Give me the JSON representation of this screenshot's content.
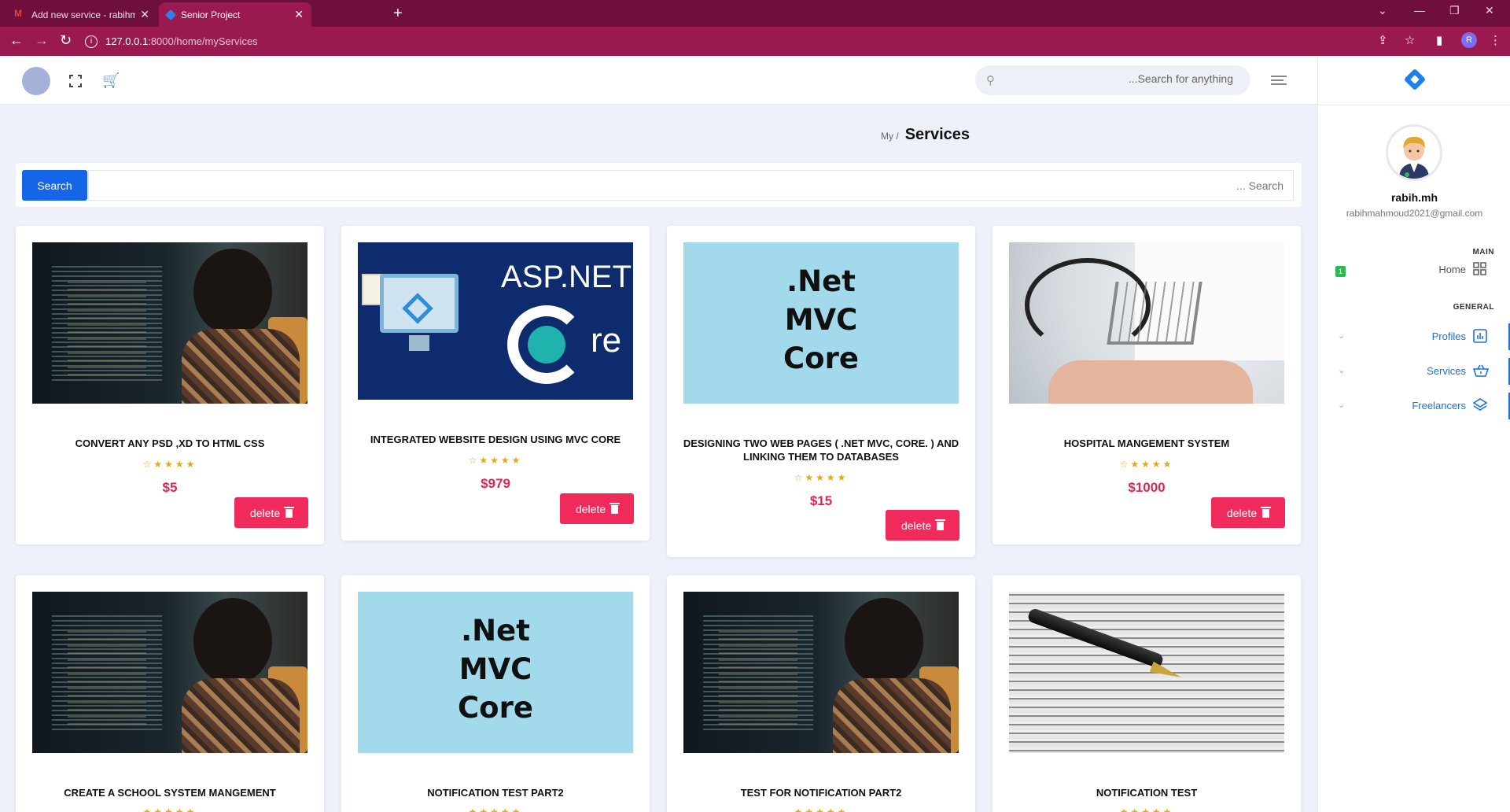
{
  "browser": {
    "tabs": [
      {
        "title": "Add new service - rabihmahmoud",
        "active": false
      },
      {
        "title": "Senior Project",
        "active": true
      }
    ],
    "url_host": "127.0.0.1",
    "url_rest": ":8000/home/myServices"
  },
  "header": {
    "search_placeholder": "...Search for anything"
  },
  "breadcrumb": {
    "parent": "My /",
    "title": "Services"
  },
  "search": {
    "button_label": "Search",
    "placeholder": "... Search"
  },
  "sidebar": {
    "user_name": "rabih.mh",
    "user_email": "rabihmahmoud2021@gmail.com",
    "section_main": "MAIN",
    "section_general": "GENERAL",
    "home_label": "Home",
    "home_badge": "1",
    "items": [
      {
        "label": "Profiles",
        "icon": "chart-icon"
      },
      {
        "label": "Services",
        "icon": "basket-icon"
      },
      {
        "label": "Freelancers",
        "icon": "layers-icon"
      }
    ]
  },
  "services": [
    {
      "title": "CONVERT ANY PSD ,XD TO HTML CSS",
      "price": "$5",
      "stars": "☆★★★★",
      "delete_label": "delete",
      "image": "programmer-coding"
    },
    {
      "title": "INTEGRATED WEBSITE DESIGN USING MVC CORE",
      "price": "$979",
      "stars": "☆★★★★",
      "delete_label": "delete",
      "image": "asp-net-core"
    },
    {
      "title": "DESIGNING TWO WEB PAGES ( .NET MVC, CORE. ) AND LINKING THEM TO DATABASES",
      "price": "$15",
      "stars": "☆★★★★",
      "delete_label": "delete",
      "image": "net-mvc-core"
    },
    {
      "title": "HOSPITAL MANGEMENT SYSTEM",
      "price": "$1000",
      "stars": "☆★★★★",
      "delete_label": "delete",
      "image": "hospital-cart"
    },
    {
      "title": "CREATE A SCHOOL SYSTEM MANGEMENT",
      "stars": "★★★★★",
      "image": "programmer-coding"
    },
    {
      "title": "NOTIFICATION TEST PART2",
      "stars": "★★★★★",
      "image": "net-mvc-core"
    },
    {
      "title": "TEST FOR NOTIFICATION PART2",
      "stars": "★★★★★",
      "image": "programmer-coding"
    },
    {
      "title": "NOTIFICATION TEST",
      "stars": "★★★★★",
      "image": "pen-paper"
    }
  ],
  "images": {
    "asp_text": "ASP.NET",
    "core_text": "re",
    "net_line1": ".Net",
    "net_line2": "MVC",
    "net_line3": "Core"
  },
  "colors": {
    "brand_tab": "#6f0f3d",
    "toolbar": "#9a1a4f",
    "primary": "#1565e8",
    "danger": "#f02b5c",
    "price": "#e3264f"
  }
}
